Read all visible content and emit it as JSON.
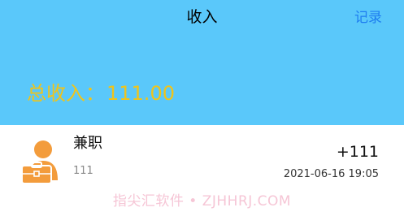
{
  "navbar": {
    "title": "收入",
    "record_label": "记录"
  },
  "summary": {
    "label": "总收入",
    "colon": "：",
    "total": "111.00"
  },
  "entries": [
    {
      "category": "兼职",
      "note": "111",
      "amount": "+111",
      "datetime": "2021-06-16 19:05",
      "icon": "part-time-job-icon"
    }
  ],
  "watermark": "指尖汇软件 • ZJHHRJ.COM",
  "colors": {
    "header_bg": "#5ac8fa",
    "total_text": "#f0c419",
    "link": "#1e7ef0",
    "icon_orange": "#f39c3c"
  }
}
